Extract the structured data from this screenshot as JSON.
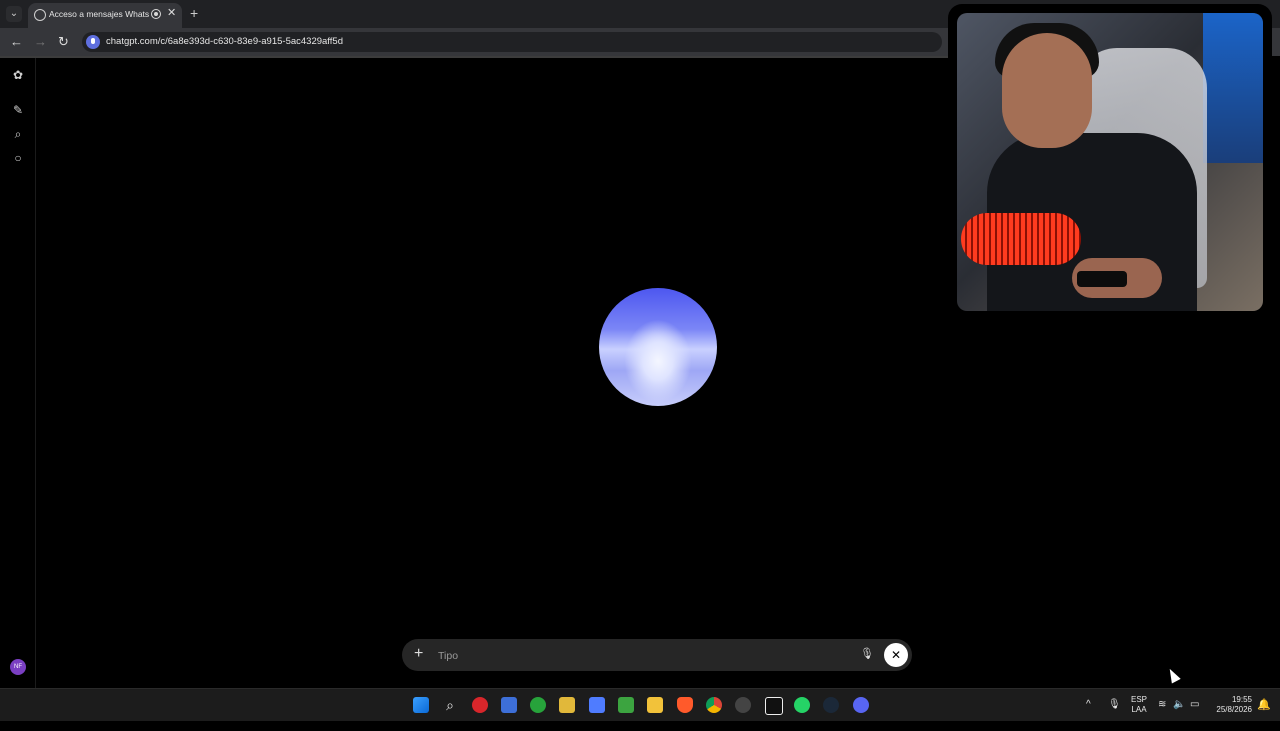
{
  "browser": {
    "tab": {
      "title": "Acceso a mensajes WhatsA",
      "close_label": "✕"
    },
    "new_tab_label": "+",
    "menu_label": "⌄",
    "nav": {
      "back": "←",
      "forward": "→",
      "reload": "↻"
    },
    "url": "chatgpt.com/c/6a8e393d-c630-83e9-a915-5ac4329aff5d"
  },
  "sidebar": {
    "icons": [
      "chatgpt-logo-icon",
      "new-chat-icon",
      "search-icon",
      "chat-bubble-icon"
    ],
    "avatar_initials": "NF"
  },
  "voice": {
    "orb_colors": [
      "#4d57f0",
      "#7b86f6",
      "#f4f6ff"
    ]
  },
  "composer": {
    "plus_label": "+",
    "placeholder": "Tipo",
    "mute_label": "🎙",
    "close_label": "✕"
  },
  "taskbar": {
    "apps": [
      "start",
      "search",
      "app",
      "store",
      "xbox",
      "app",
      "app",
      "minecraft",
      "file-explorer",
      "brave",
      "chrome",
      "app",
      "capcut",
      "whatsapp",
      "steam",
      "discord"
    ],
    "tray": {
      "chevron": "^",
      "mic": "🎙",
      "lang_line1": "ESP",
      "lang_line2": "LAA",
      "wifi": "≋",
      "volume": "🔈",
      "battery": "▭",
      "time": "19:55",
      "date": "25/8/2026",
      "notifications": "🔔"
    }
  },
  "colors": {
    "tab_strip": "#202124",
    "toolbar": "#35363a",
    "background": "#000000",
    "composer": "#262626"
  }
}
